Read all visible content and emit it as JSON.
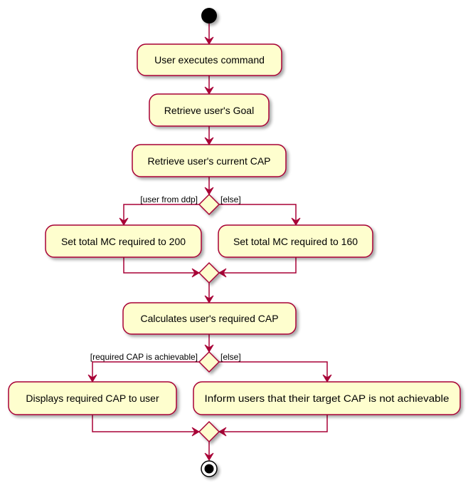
{
  "diagram": {
    "type": "uml-activity",
    "colors": {
      "border": "#A80036",
      "fill": "#FEFECE",
      "start": "#000000",
      "background": "#FFFFFF"
    },
    "nodes": {
      "start": {
        "kind": "start"
      },
      "a1": {
        "kind": "action",
        "label": "User executes command"
      },
      "a2": {
        "kind": "action",
        "label": "Retrieve user's Goal"
      },
      "a3": {
        "kind": "action",
        "label": "Retrieve user's current CAP"
      },
      "d1": {
        "kind": "decision",
        "left_guard": "[user from ddp]",
        "right_guard": "[else]"
      },
      "a4": {
        "kind": "action",
        "label": "Set total MC required to 200"
      },
      "a5": {
        "kind": "action",
        "label": "Set total MC required to 160"
      },
      "m1": {
        "kind": "merge"
      },
      "a6": {
        "kind": "action",
        "label": "Calculates user's required CAP"
      },
      "d2": {
        "kind": "decision",
        "left_guard": "[required CAP is achievable]",
        "right_guard": "[else]"
      },
      "a7": {
        "kind": "action",
        "label": "Displays required CAP to user"
      },
      "a8": {
        "kind": "action",
        "label": "Inform users that their target CAP is not achievable"
      },
      "m2": {
        "kind": "merge"
      },
      "end": {
        "kind": "end"
      }
    },
    "edges": [
      [
        "start",
        "a1"
      ],
      [
        "a1",
        "a2"
      ],
      [
        "a2",
        "a3"
      ],
      [
        "a3",
        "d1"
      ],
      [
        "d1",
        "a4"
      ],
      [
        "d1",
        "a5"
      ],
      [
        "a4",
        "m1"
      ],
      [
        "a5",
        "m1"
      ],
      [
        "m1",
        "a6"
      ],
      [
        "a6",
        "d2"
      ],
      [
        "d2",
        "a7"
      ],
      [
        "d2",
        "a8"
      ],
      [
        "a7",
        "m2"
      ],
      [
        "a8",
        "m2"
      ],
      [
        "m2",
        "end"
      ]
    ]
  }
}
